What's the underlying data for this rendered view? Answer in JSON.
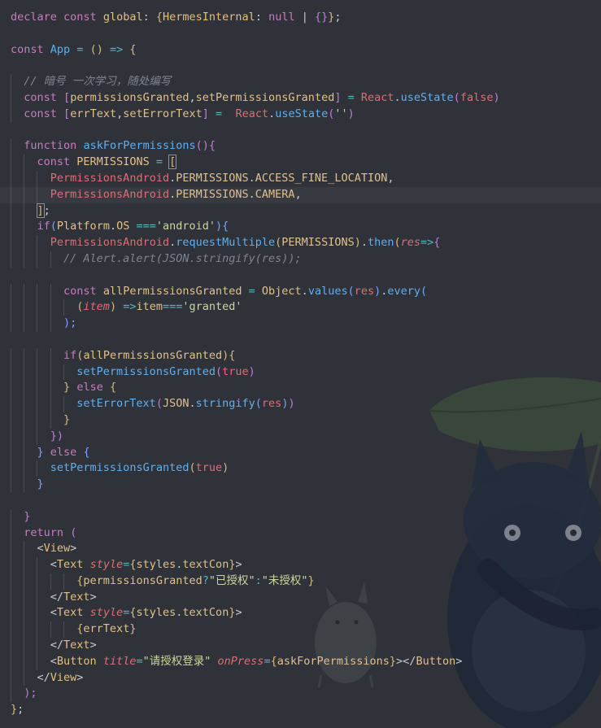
{
  "colors": {
    "background": "#2f3239",
    "keyword": "#c77dbd",
    "storage": "#d09ae8",
    "variable": "#e2c08d",
    "function": "#61afef",
    "type": "#e5c07b",
    "string": "#c9d79c",
    "react_ident": "#e06c75",
    "comment": "#7f848e",
    "operator": "#56b6c2",
    "plain": "#c8cbd2",
    "bracket_gold": "#d7ba7d",
    "bracket_violet": "#c678dd",
    "bracket_blue": "#7aa2f7",
    "tag": "#e5c07b",
    "param": "#e06c75"
  },
  "editor": {
    "background_art": "totoro-illustration",
    "lines": [
      [
        [
          "declare",
          "kw"
        ],
        [
          " ",
          "p"
        ],
        [
          "const",
          "kw"
        ],
        [
          " ",
          "p"
        ],
        [
          "global",
          "var"
        ],
        [
          ": ",
          "p"
        ],
        [
          "{",
          "bg"
        ],
        [
          "HermesInternal",
          "ty"
        ],
        [
          ": ",
          "p"
        ],
        [
          "null",
          "kw"
        ],
        [
          " | ",
          "p"
        ],
        [
          "{}",
          "bv"
        ],
        [
          "}",
          "bg"
        ],
        [
          ";",
          "p"
        ]
      ],
      [],
      [
        [
          "const",
          "kw"
        ],
        [
          " ",
          "p"
        ],
        [
          "App",
          "fn"
        ],
        [
          " = ",
          "op"
        ],
        [
          "()",
          "bg"
        ],
        [
          " => ",
          "op"
        ],
        [
          "{",
          "bg"
        ]
      ],
      [],
      [
        [
          "  ",
          "p"
        ],
        [
          "// 暗号 一次学习，随处编写",
          "cm"
        ]
      ],
      [
        [
          "  ",
          "p"
        ],
        [
          "const",
          "kw"
        ],
        [
          " ",
          "p"
        ],
        [
          "[",
          "bv"
        ],
        [
          "permissionsGranted",
          "var"
        ],
        [
          ",",
          "p"
        ],
        [
          "setPermissionsGranted",
          "var"
        ],
        [
          "]",
          "bv"
        ],
        [
          " = ",
          "op"
        ],
        [
          "React",
          "rc"
        ],
        [
          ".",
          "p"
        ],
        [
          "useState",
          "fn"
        ],
        [
          "(",
          "bv"
        ],
        [
          "false",
          "pm"
        ],
        [
          ")",
          "bv"
        ]
      ],
      [
        [
          "  ",
          "p"
        ],
        [
          "const",
          "kw"
        ],
        [
          " ",
          "p"
        ],
        [
          "[",
          "bv"
        ],
        [
          "errText",
          "var"
        ],
        [
          ",",
          "p"
        ],
        [
          "setErrorText",
          "var"
        ],
        [
          "]",
          "bv"
        ],
        [
          " =  ",
          "op"
        ],
        [
          "React",
          "rc"
        ],
        [
          ".",
          "p"
        ],
        [
          "useState",
          "fn"
        ],
        [
          "(",
          "bv"
        ],
        [
          "''",
          "st"
        ],
        [
          ")",
          "bv"
        ]
      ],
      [],
      [
        [
          "  ",
          "p"
        ],
        [
          "function",
          "kw"
        ],
        [
          " ",
          "p"
        ],
        [
          "askForPermissions",
          "fn"
        ],
        [
          "(){",
          "bv"
        ]
      ],
      [
        [
          "    ",
          "p"
        ],
        [
          "const",
          "kw"
        ],
        [
          " ",
          "p"
        ],
        [
          "PERMISSIONS",
          "var"
        ],
        [
          " = ",
          "op"
        ],
        [
          "[",
          "bx"
        ]
      ],
      [
        [
          "      ",
          "p"
        ],
        [
          "PermissionsAndroid",
          "rc"
        ],
        [
          ".",
          "p"
        ],
        [
          "PERMISSIONS",
          "var"
        ],
        [
          ".",
          "p"
        ],
        [
          "ACCESS_FINE_LOCATION",
          "var"
        ],
        [
          ",",
          "p"
        ]
      ],
      [
        [
          "      ",
          "p"
        ],
        [
          "PermissionsAndroid",
          "rc"
        ],
        [
          ".",
          "p"
        ],
        [
          "PERMISSIONS",
          "var"
        ],
        [
          ".",
          "p"
        ],
        [
          "CAMERA",
          "var"
        ],
        [
          ",",
          "p"
        ]
      ],
      [
        [
          "    ",
          "p"
        ],
        [
          "]",
          "bx"
        ],
        [
          ";",
          "p"
        ]
      ],
      [
        [
          "    ",
          "p"
        ],
        [
          "if",
          "kw"
        ],
        [
          "(",
          "bb"
        ],
        [
          "Platform",
          "var"
        ],
        [
          ".",
          "p"
        ],
        [
          "OS",
          "var"
        ],
        [
          " ===",
          "op"
        ],
        [
          "'android'",
          "st"
        ],
        [
          ")",
          "bb"
        ],
        [
          "{",
          "bb"
        ]
      ],
      [
        [
          "      ",
          "p"
        ],
        [
          "PermissionsAndroid",
          "rc"
        ],
        [
          ".",
          "p"
        ],
        [
          "requestMultiple",
          "fn"
        ],
        [
          "(",
          "bg"
        ],
        [
          "PERMISSIONS",
          "var"
        ],
        [
          ")",
          "bg"
        ],
        [
          ".",
          "p"
        ],
        [
          "then",
          "fn"
        ],
        [
          "(",
          "bg"
        ],
        [
          "res",
          "pi"
        ],
        [
          "=>",
          "op"
        ],
        [
          "{",
          "bv"
        ]
      ],
      [
        [
          "        ",
          "p"
        ],
        [
          "// Alert.alert(JSON.stringify(res));",
          "ci"
        ]
      ],
      [],
      [
        [
          "        ",
          "p"
        ],
        [
          "const",
          "kw"
        ],
        [
          " ",
          "p"
        ],
        [
          "allPermissionsGranted",
          "var"
        ],
        [
          " = ",
          "op"
        ],
        [
          "Object",
          "var"
        ],
        [
          ".",
          "p"
        ],
        [
          "values",
          "fn"
        ],
        [
          "(",
          "bb"
        ],
        [
          "res",
          "pm"
        ],
        [
          ")",
          "bb"
        ],
        [
          ".",
          "p"
        ],
        [
          "every",
          "fn"
        ],
        [
          "(",
          "bb"
        ]
      ],
      [
        [
          "          ",
          "p"
        ],
        [
          "(",
          "bg"
        ],
        [
          "item",
          "pi"
        ],
        [
          ")",
          "bg"
        ],
        [
          " =>",
          "op"
        ],
        [
          "item",
          "var"
        ],
        [
          "===",
          "op"
        ],
        [
          "'granted'",
          "st"
        ]
      ],
      [
        [
          "        ",
          "p"
        ],
        [
          ");",
          "bb"
        ]
      ],
      [],
      [
        [
          "        ",
          "p"
        ],
        [
          "if",
          "kw"
        ],
        [
          "(",
          "bg"
        ],
        [
          "allPermissionsGranted",
          "var"
        ],
        [
          ")",
          "bg"
        ],
        [
          "{",
          "bg"
        ]
      ],
      [
        [
          "          ",
          "p"
        ],
        [
          "setPermissionsGranted",
          "fn"
        ],
        [
          "(",
          "bv"
        ],
        [
          "true",
          "pm"
        ],
        [
          ")",
          "bv"
        ]
      ],
      [
        [
          "        ",
          "p"
        ],
        [
          "}",
          "bg"
        ],
        [
          " ",
          "p"
        ],
        [
          "else",
          "kw"
        ],
        [
          " ",
          "p"
        ],
        [
          "{",
          "bg"
        ]
      ],
      [
        [
          "          ",
          "p"
        ],
        [
          "setErrorText",
          "fn"
        ],
        [
          "(",
          "bv"
        ],
        [
          "JSON",
          "var"
        ],
        [
          ".",
          "p"
        ],
        [
          "stringify",
          "fn"
        ],
        [
          "(",
          "bb"
        ],
        [
          "res",
          "pm"
        ],
        [
          ")",
          "bb"
        ],
        [
          ")",
          "bv"
        ]
      ],
      [
        [
          "        ",
          "p"
        ],
        [
          "}",
          "bg"
        ]
      ],
      [
        [
          "      ",
          "p"
        ],
        [
          "})",
          "bv"
        ]
      ],
      [
        [
          "    ",
          "p"
        ],
        [
          "}",
          "bb"
        ],
        [
          " ",
          "p"
        ],
        [
          "else",
          "kw"
        ],
        [
          " ",
          "p"
        ],
        [
          "{",
          "bb"
        ]
      ],
      [
        [
          "      ",
          "p"
        ],
        [
          "setPermissionsGranted",
          "fn"
        ],
        [
          "(",
          "bg"
        ],
        [
          "true",
          "pm"
        ],
        [
          ")",
          "bg"
        ]
      ],
      [
        [
          "    ",
          "p"
        ],
        [
          "}",
          "bb"
        ]
      ],
      [],
      [
        [
          "  ",
          "p"
        ],
        [
          "}",
          "bv"
        ]
      ],
      [
        [
          "  ",
          "p"
        ],
        [
          "return",
          "kw"
        ],
        [
          " ",
          "p"
        ],
        [
          "(",
          "bv"
        ]
      ],
      [
        [
          "    ",
          "p"
        ],
        [
          "<",
          "p"
        ],
        [
          "View",
          "tg"
        ],
        [
          ">",
          "p"
        ]
      ],
      [
        [
          "      ",
          "p"
        ],
        [
          "<",
          "p"
        ],
        [
          "Text",
          "tg"
        ],
        [
          " ",
          "p"
        ],
        [
          "style",
          "at"
        ],
        [
          "=",
          "op"
        ],
        [
          "{",
          "bg"
        ],
        [
          "styles",
          "var"
        ],
        [
          ".",
          "p"
        ],
        [
          "textCon",
          "var"
        ],
        [
          "}",
          "bg"
        ],
        [
          ">",
          "p"
        ]
      ],
      [
        [
          "          ",
          "p"
        ],
        [
          "{",
          "bg"
        ],
        [
          "permissionsGranted",
          "var"
        ],
        [
          "?",
          "op"
        ],
        [
          "\"已授权\"",
          "st"
        ],
        [
          ":",
          "op"
        ],
        [
          "\"未授权\"",
          "st"
        ],
        [
          "}",
          "bg"
        ]
      ],
      [
        [
          "      ",
          "p"
        ],
        [
          "</",
          "p"
        ],
        [
          "Text",
          "tg"
        ],
        [
          ">",
          "p"
        ]
      ],
      [
        [
          "      ",
          "p"
        ],
        [
          "<",
          "p"
        ],
        [
          "Text",
          "tg"
        ],
        [
          " ",
          "p"
        ],
        [
          "style",
          "at"
        ],
        [
          "=",
          "op"
        ],
        [
          "{",
          "bg"
        ],
        [
          "styles",
          "var"
        ],
        [
          ".",
          "p"
        ],
        [
          "textCon",
          "var"
        ],
        [
          "}",
          "bg"
        ],
        [
          ">",
          "p"
        ]
      ],
      [
        [
          "          ",
          "p"
        ],
        [
          "{",
          "bg"
        ],
        [
          "errText",
          "var"
        ],
        [
          "}",
          "bg"
        ]
      ],
      [
        [
          "      ",
          "p"
        ],
        [
          "</",
          "p"
        ],
        [
          "Text",
          "tg"
        ],
        [
          ">",
          "p"
        ]
      ],
      [
        [
          "      ",
          "p"
        ],
        [
          "<",
          "p"
        ],
        [
          "Button",
          "tg"
        ],
        [
          " ",
          "p"
        ],
        [
          "title",
          "at"
        ],
        [
          "=",
          "op"
        ],
        [
          "\"请授权登录\"",
          "st"
        ],
        [
          " ",
          "p"
        ],
        [
          "onPress",
          "at"
        ],
        [
          "=",
          "op"
        ],
        [
          "{",
          "bg"
        ],
        [
          "askForPermissions",
          "var"
        ],
        [
          "}",
          "bg"
        ],
        [
          ">",
          "p"
        ],
        [
          "</",
          "p"
        ],
        [
          "Button",
          "tg"
        ],
        [
          ">",
          "p"
        ]
      ],
      [
        [
          "    ",
          "p"
        ],
        [
          "</",
          "p"
        ],
        [
          "View",
          "tg"
        ],
        [
          ">",
          "p"
        ]
      ],
      [
        [
          "  ",
          "p"
        ],
        [
          ");",
          "bv"
        ]
      ],
      [
        [
          "}",
          "bg"
        ],
        [
          ";",
          "p"
        ]
      ]
    ]
  }
}
